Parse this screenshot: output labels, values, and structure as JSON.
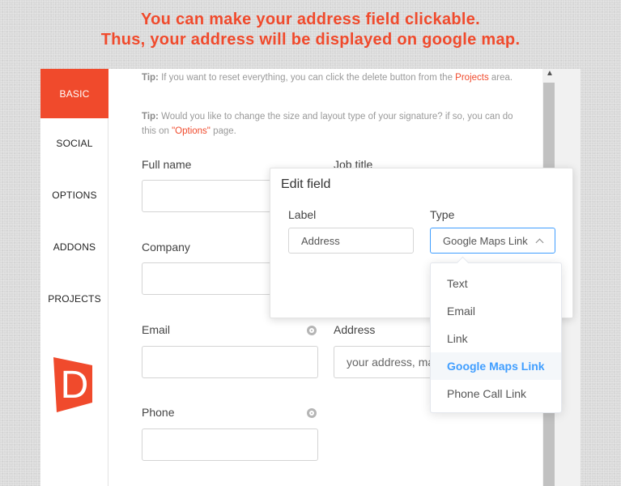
{
  "headline": {
    "line1": "You can make your address field clickable.",
    "line2": "Thus, your address will be displayed on google map."
  },
  "sidebar": {
    "items": [
      {
        "label": "BASIC",
        "active": true
      },
      {
        "label": "SOCIAL",
        "active": false
      },
      {
        "label": "OPTIONS",
        "active": false
      },
      {
        "label": "ADDONS",
        "active": false
      },
      {
        "label": "PROJECTS",
        "active": false
      }
    ],
    "logo_letter": "D"
  },
  "tips": {
    "tip1_prefix": "Tip:",
    "tip1_text": " If you want to reset everything, you can click the delete button from the ",
    "tip1_link": "Projects",
    "tip1_suffix": " area.",
    "tip2_prefix": "Tip:",
    "tip2_text": " Would you like to change the size and layout type of your signature? if so, you can do this on ",
    "tip2_link": "\"Options\"",
    "tip2_suffix": " page."
  },
  "form": {
    "full_name_label": "Full name",
    "job_title_label": "Job title",
    "company_label": "Company",
    "email_label": "Email",
    "address_label": "Address",
    "address_value": "your address, ma",
    "phone_label": "Phone"
  },
  "edit_field": {
    "title": "Edit field",
    "label_heading": "Label",
    "label_value": "Address",
    "type_heading": "Type",
    "type_value": "Google Maps Link",
    "options": [
      "Text",
      "Email",
      "Link",
      "Google Maps Link",
      "Phone Call Link"
    ],
    "selected_option": "Google Maps Link"
  },
  "colors": {
    "accent": "#f04a2c",
    "select_focus": "#409eff"
  }
}
